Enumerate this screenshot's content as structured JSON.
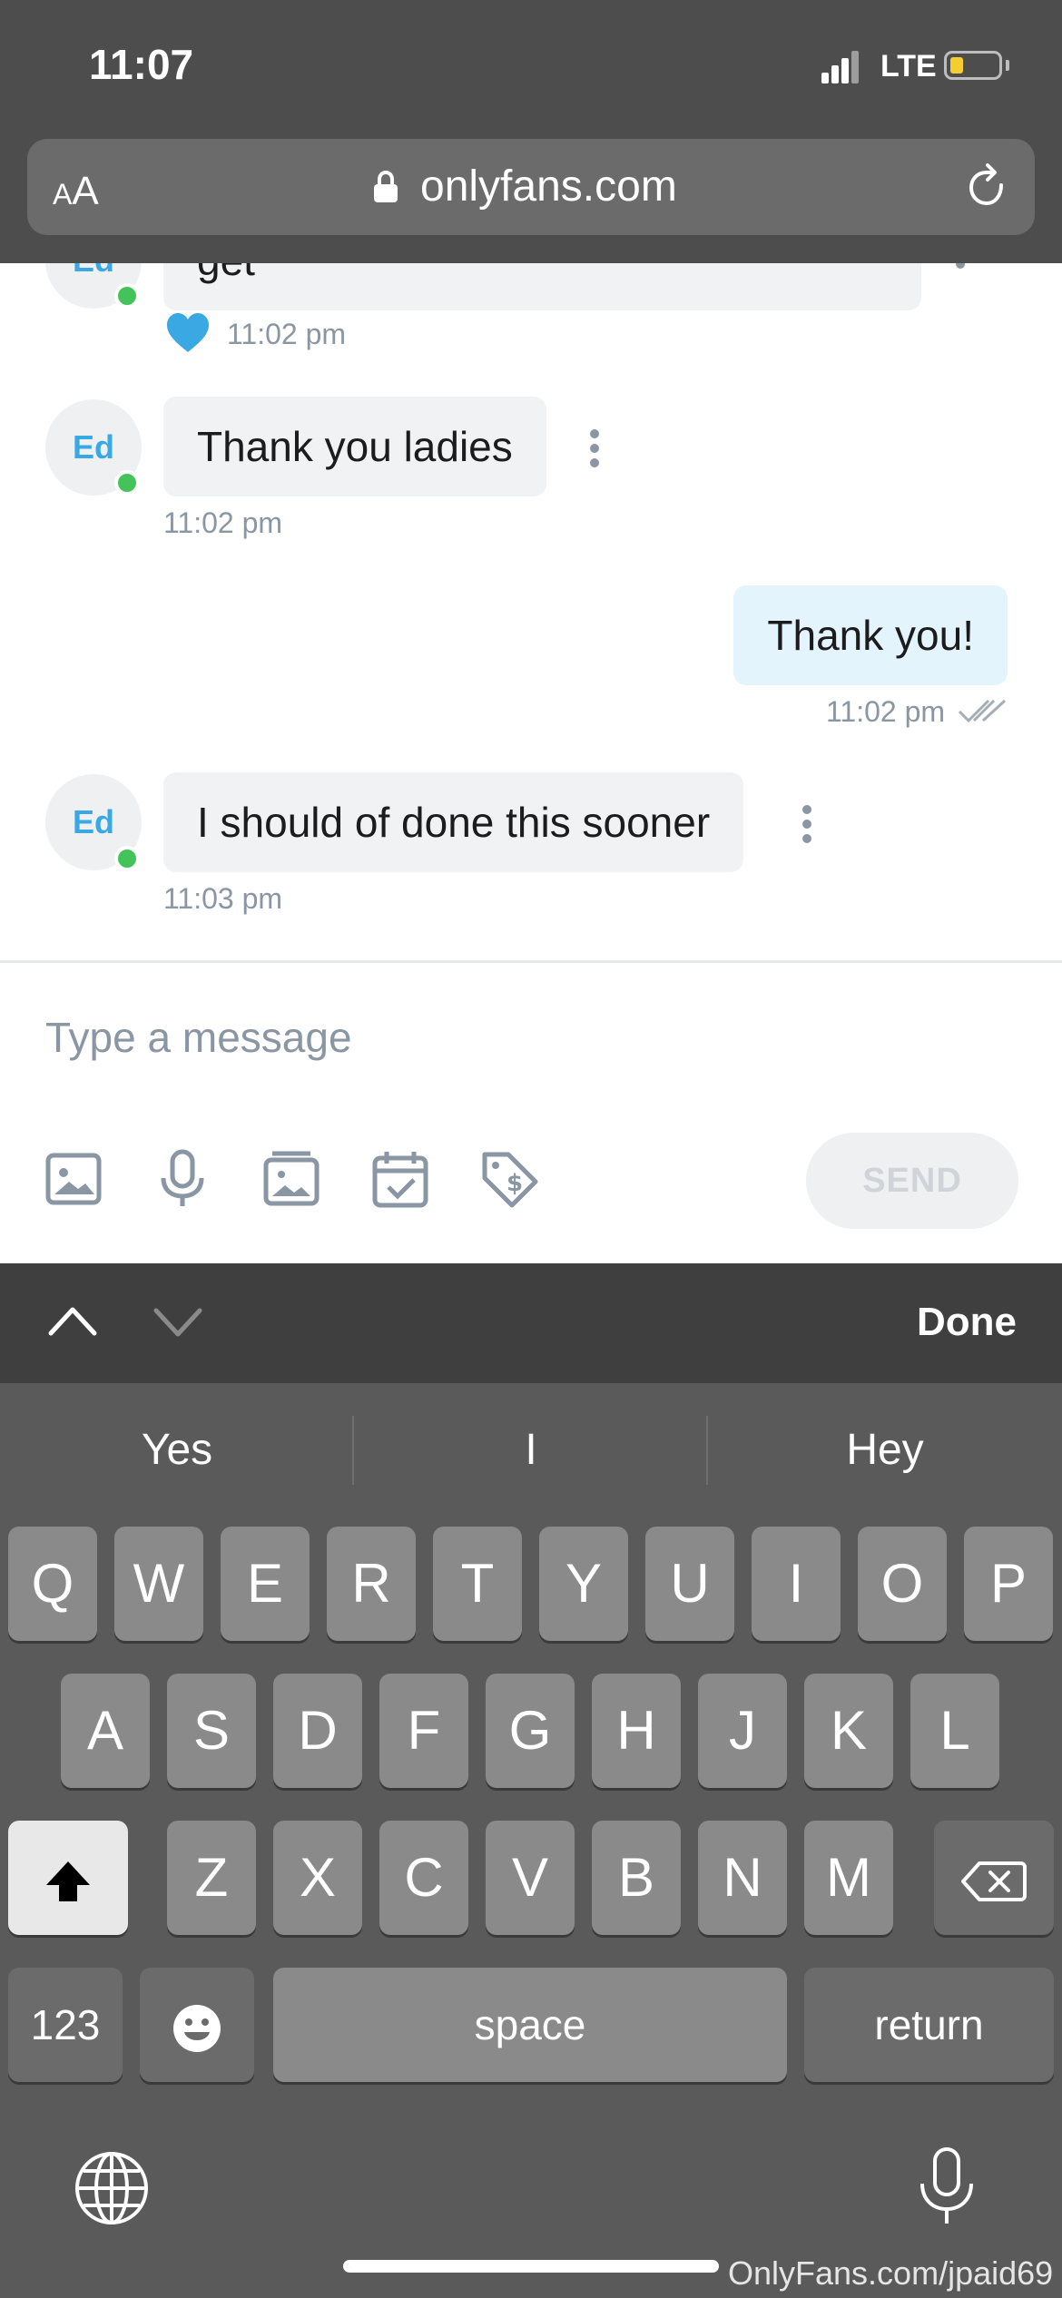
{
  "status_bar": {
    "time": "11:07",
    "network": "LTE"
  },
  "browser": {
    "text_size_label_small": "A",
    "text_size_label_large": "A",
    "url": "onlyfans.com"
  },
  "chat": {
    "partial_message": {
      "text": "get",
      "avatar_label": "Ed",
      "time": "11:02 pm",
      "reaction": "heart-icon"
    },
    "messages": [
      {
        "sender": "Ed",
        "from_me": false,
        "text": "Thank you ladies",
        "time": "11:02 pm"
      },
      {
        "from_me": true,
        "text": "Thank you!",
        "time": "11:02 pm",
        "read": true
      },
      {
        "sender": "Ed",
        "from_me": false,
        "text": "I should of done this sooner",
        "time": "11:03 pm"
      }
    ]
  },
  "composer": {
    "placeholder": "Type a message",
    "tools": [
      "image-icon",
      "microphone-icon",
      "gallery-icon",
      "calendar-icon",
      "price-tag-icon"
    ],
    "send_label": "SEND"
  },
  "keyboard": {
    "done_label": "Done",
    "suggestions": [
      "Yes",
      "I",
      "Hey"
    ],
    "row1": [
      "Q",
      "W",
      "E",
      "R",
      "T",
      "Y",
      "U",
      "I",
      "O",
      "P"
    ],
    "row2": [
      "A",
      "S",
      "D",
      "F",
      "G",
      "H",
      "J",
      "K",
      "L"
    ],
    "row3": [
      "Z",
      "X",
      "C",
      "V",
      "B",
      "N",
      "M"
    ],
    "numbers_label": "123",
    "space_label": "space",
    "return_label": "return"
  },
  "watermark": "OnlyFans.com/jpaid69",
  "colors": {
    "accent": "#3aa8e2",
    "online": "#45c35b",
    "heart": "#3aa8e2"
  }
}
